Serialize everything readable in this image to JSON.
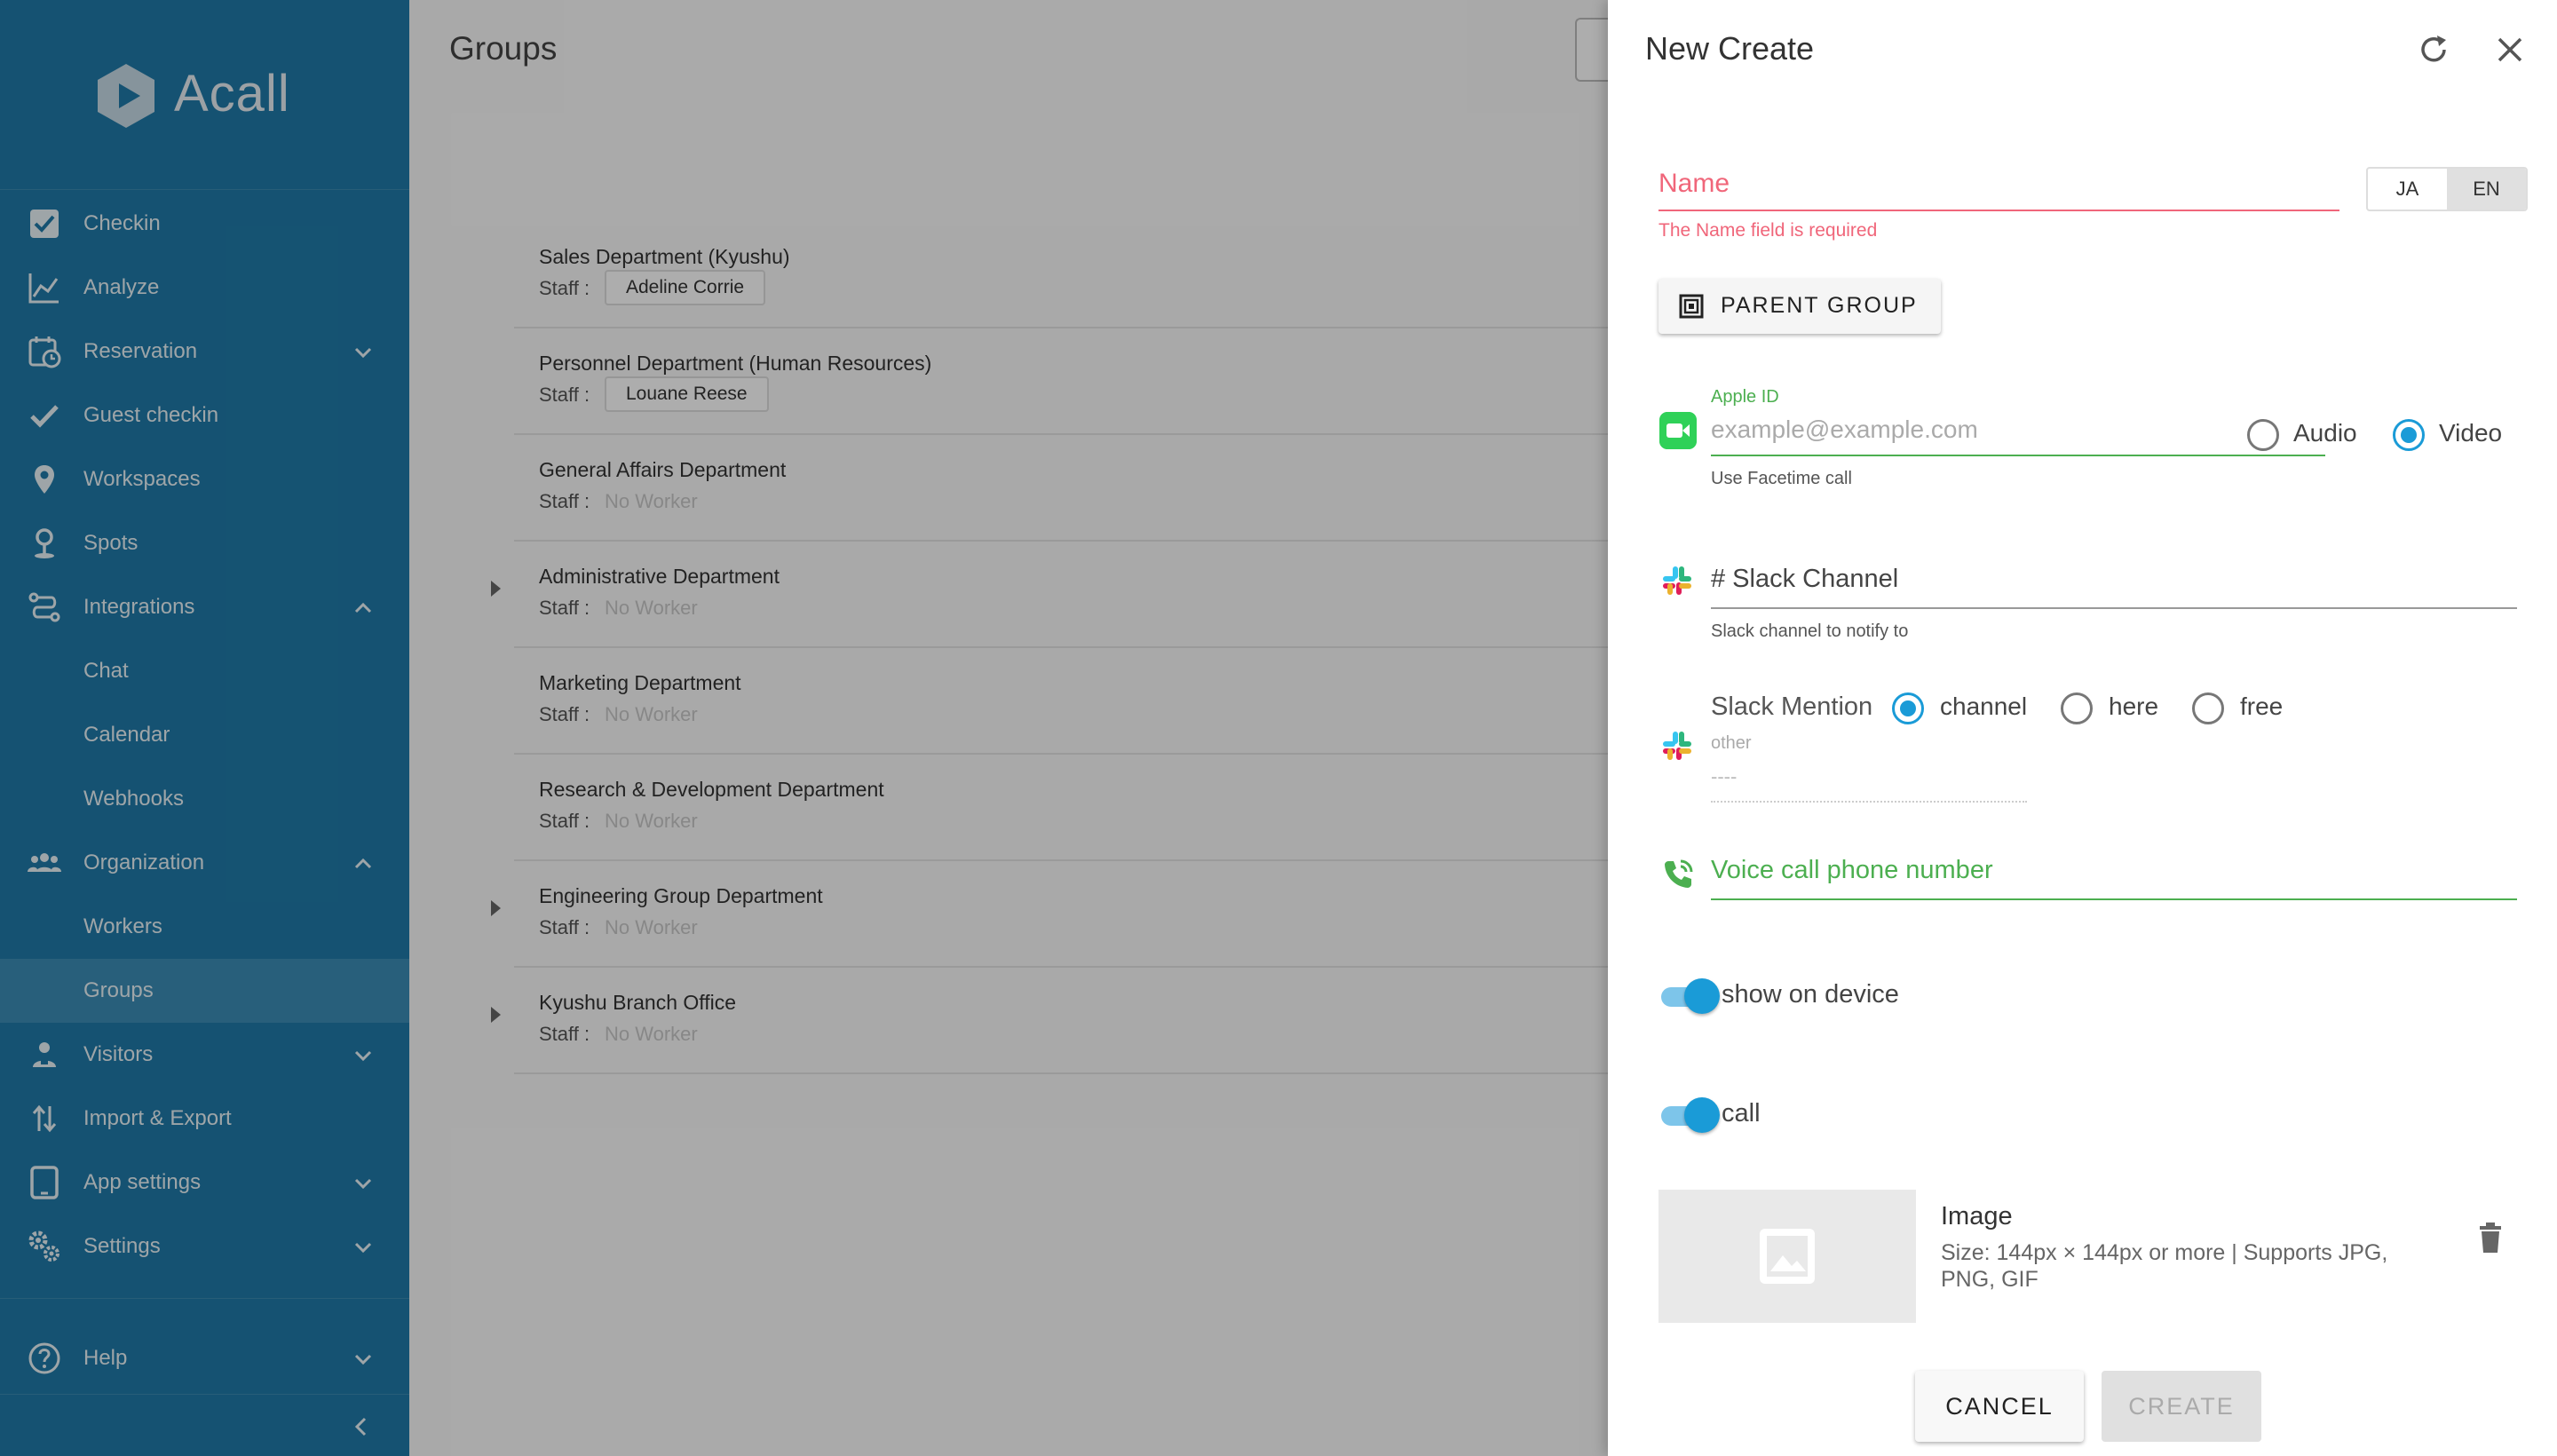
{
  "app": {
    "name": "Acall"
  },
  "sidebar": {
    "items": [
      {
        "label": "Checkin"
      },
      {
        "label": "Analyze"
      },
      {
        "label": "Reservation"
      },
      {
        "label": "Guest checkin"
      },
      {
        "label": "Workspaces"
      },
      {
        "label": "Spots"
      },
      {
        "label": "Integrations"
      },
      {
        "label": "Chat"
      },
      {
        "label": "Calendar"
      },
      {
        "label": "Webhooks"
      },
      {
        "label": "Organization"
      },
      {
        "label": "Workers"
      },
      {
        "label": "Groups"
      },
      {
        "label": "Visitors"
      },
      {
        "label": "Import & Export"
      },
      {
        "label": "App settings"
      },
      {
        "label": "Settings"
      },
      {
        "label": "Help"
      }
    ]
  },
  "main": {
    "title": "Groups",
    "staff_label": "Staff :",
    "no_worker": "No Worker",
    "groups": [
      {
        "name": "Sales Department (Kyushu)",
        "staff": "Adeline Corrie"
      },
      {
        "name": "Personnel Department (Human Resources)",
        "staff": "Louane Reese"
      },
      {
        "name": "General Affairs Department",
        "staff": ""
      },
      {
        "name": "Administrative Department",
        "staff": ""
      },
      {
        "name": "Marketing Department",
        "staff": ""
      },
      {
        "name": "Research & Development Department",
        "staff": ""
      },
      {
        "name": "Engineering Group Department",
        "staff": ""
      },
      {
        "name": "Kyushu Branch Office",
        "staff": ""
      }
    ]
  },
  "drawer": {
    "title": "New Create",
    "name_label": "Name",
    "name_error": "The Name field is required",
    "lang": {
      "ja": "JA",
      "en": "EN",
      "selected": "EN"
    },
    "parent_group_label": "PARENT GROUP",
    "apple_id": {
      "label": "Apple ID",
      "placeholder": "example@example.com",
      "hint": "Use Facetime call",
      "options": [
        "Audio",
        "Video"
      ],
      "selected": "Video"
    },
    "slack_channel": {
      "value": "# Slack Channel",
      "hint": "Slack channel to notify to"
    },
    "slack_mention": {
      "label": "Slack Mention",
      "options": [
        "channel",
        "here",
        "free"
      ],
      "selected": "channel",
      "other_label": "other",
      "other_value": "----"
    },
    "voice_phone_label": "Voice call phone number",
    "show_on_device": {
      "label": "show on device",
      "on": true
    },
    "call": {
      "label": "call",
      "on": true
    },
    "image": {
      "title": "Image",
      "description": "Size: 144px × 144px or more | Supports JPG, PNG, GIF"
    },
    "cancel_label": "CANCEL",
    "create_label": "CREATE"
  },
  "colors": {
    "sidebar_bg": "#1f7aa8",
    "accent": "#1a9bd7",
    "error": "#f0667a",
    "success": "#4caf50"
  }
}
